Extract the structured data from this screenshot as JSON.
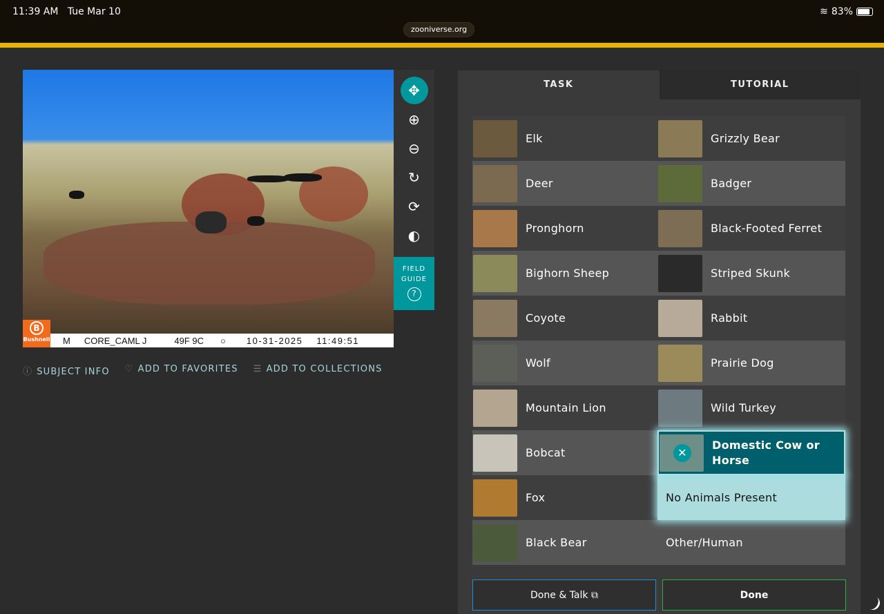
{
  "status": {
    "time": "11:39 AM",
    "date": "Tue Mar 10",
    "battery": "83%",
    "battery_level": 83,
    "url": "zooniverse.org"
  },
  "photo": {
    "brand": "Bushnell",
    "camera": "CORE_CAML J",
    "temp": "49F 9C",
    "date": "10-31-2025",
    "time": "11:49:51",
    "mode": "M"
  },
  "tools": {
    "field_guide": "FIELD GUIDE",
    "help": "?"
  },
  "meta": {
    "subject_info": "SUBJECT INFO",
    "favorites": "ADD TO FAVORITES",
    "collections": "ADD TO COLLECTIONS"
  },
  "tabs": {
    "task": "TASK",
    "tutorial": "TUTORIAL"
  },
  "choices": [
    {
      "label": "Elk",
      "color": "#6b5a3e"
    },
    {
      "label": "Grizzly Bear",
      "color": "#8a7a55"
    },
    {
      "label": "Deer",
      "color": "#7c6a50"
    },
    {
      "label": "Badger",
      "color": "#5d6a3a"
    },
    {
      "label": "Pronghorn",
      "color": "#a8784a"
    },
    {
      "label": "Black-Footed Ferret",
      "color": "#7e6d55"
    },
    {
      "label": "Bighorn Sheep",
      "color": "#8b8a5a"
    },
    {
      "label": "Striped Skunk",
      "color": "#2a2a2a"
    },
    {
      "label": "Coyote",
      "color": "#8a7a62"
    },
    {
      "label": "Rabbit",
      "color": "#b8aa98"
    },
    {
      "label": "Wolf",
      "color": "#5c5e58"
    },
    {
      "label": "Prairie Dog",
      "color": "#9b8a5a"
    },
    {
      "label": "Mountain Lion",
      "color": "#b3a590"
    },
    {
      "label": "Wild Turkey",
      "color": "#6d7a80"
    },
    {
      "label": "Bobcat",
      "color": "#c9c4ba"
    },
    {
      "label": "Domestic Cow or Horse",
      "color": "#6e8f87"
    },
    {
      "label": "Fox",
      "color": "#b07a30"
    },
    {
      "label": "No Animals Present"
    },
    {
      "label": "Black Bear",
      "color": "#4a5a3a"
    },
    {
      "label": "Other/Human"
    }
  ],
  "buttons": {
    "done_talk": "Done & Talk",
    "done": "Done"
  }
}
